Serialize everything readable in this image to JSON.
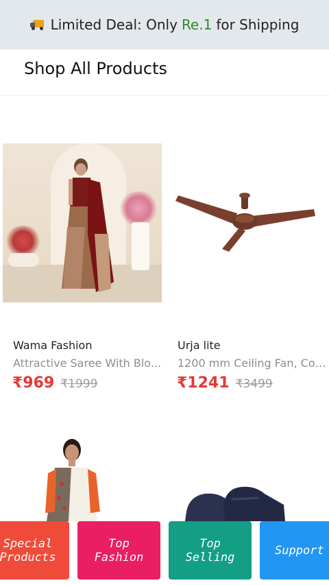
{
  "banner": {
    "icon": "delivery-truck-icon",
    "prefix": "Limited Deal: Only",
    "price": "Re.1",
    "suffix": "for Shipping",
    "price_color": "#2e8b2e"
  },
  "header": {
    "title": "Shop All Products"
  },
  "products": [
    {
      "image": "saree-image",
      "brand": "Wama Fashion",
      "description": "Attractive Saree With Blo...",
      "price": "₹969",
      "mrp": "₹1999"
    },
    {
      "image": "ceiling-fan-image",
      "brand": "Urja lite",
      "description": "1200 mm Ceiling Fan, Cop...",
      "price": "₹1241",
      "mrp": "₹3499"
    }
  ],
  "partial_products": [
    {
      "image": "kurti-image"
    },
    {
      "image": "shoes-image"
    }
  ],
  "bottom_nav": [
    {
      "label": "Special\nProducts",
      "color": "#f04a3a"
    },
    {
      "label": "Top\nFashion",
      "color": "#e91e63"
    },
    {
      "label": "Top\nSelling",
      "color": "#139e86"
    },
    {
      "label": "Support",
      "color": "#2196f3"
    }
  ],
  "colors": {
    "sale_price": "#e53935",
    "mrp": "#9a9a9a",
    "banner_bg": "#e3e8ec"
  }
}
